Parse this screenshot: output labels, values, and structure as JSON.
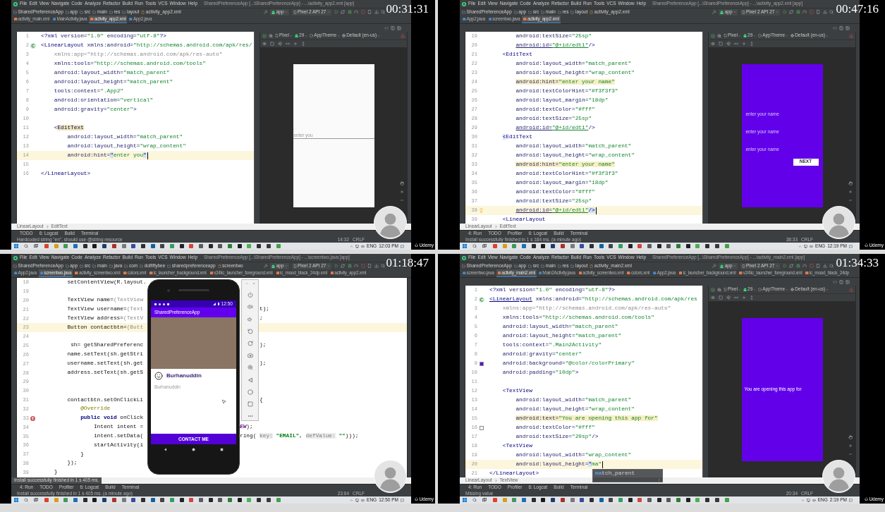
{
  "frames": [
    {
      "timestamp": "00:31:31",
      "menu": [
        "File",
        "Edit",
        "View",
        "Navigate",
        "Code",
        "Analyze",
        "Refactor",
        "Build",
        "Run",
        "Tools",
        "VCS",
        "Window",
        "Help"
      ],
      "window_title": "SharedPreferenceApp [...\\SharedPreferenceApp] - ...\\activity_app2.xml [app]",
      "path": [
        "SharedPreferenceApp",
        "app",
        "src",
        "main",
        "res",
        "layout",
        "activity_app2.xml"
      ],
      "run_config": "app",
      "device": "Pixel 2 API 27",
      "tabs": [
        {
          "label": "activity_main.xml",
          "kind": "xml",
          "selected": false
        },
        {
          "label": "MainActivity.java",
          "kind": "java",
          "selected": false
        },
        {
          "label": "activity_app2.xml",
          "kind": "xml",
          "selected": true
        },
        {
          "label": "App2.java",
          "kind": "java",
          "selected": false
        }
      ],
      "editor": {
        "lines": [
          {
            "number": "1",
            "current": false,
            "caret": false,
            "tokens": [
              {
                "kind": "tag",
                "text": "<?xml"
              },
              {
                "kind": "attr",
                "text": " version="
              },
              {
                "kind": "value",
                "text": "\"1.0\""
              },
              {
                "kind": "attr",
                "text": " encoding="
              },
              {
                "kind": "value",
                "text": "\"utf-8\""
              },
              {
                "kind": "tag",
                "text": "?>"
              }
            ]
          },
          {
            "number": "2",
            "current": false,
            "caret": false,
            "gutter": {
              "kind": "class"
            },
            "tokens": [
              {
                "kind": "tag",
                "text": "<LinearLayout"
              },
              {
                "kind": "attr",
                "text": " xmlns:android="
              },
              {
                "kind": "value",
                "text": "\"http://schemas.android.com/apk/res/"
              }
            ]
          },
          {
            "number": "3",
            "current": false,
            "caret": false,
            "tokens": [
              {
                "kind": "unused",
                "text": "    xmlns:app=\"http://schemas.android.com/apk/res-auto\""
              }
            ]
          },
          {
            "number": "4",
            "current": false,
            "caret": false,
            "tokens": [
              {
                "kind": "attr",
                "text": "    xmlns:tools="
              },
              {
                "kind": "value",
                "text": "\"http://schemas.android.com/tools\""
              }
            ]
          },
          {
            "number": "5",
            "current": false,
            "caret": false,
            "tokens": [
              {
                "kind": "attr",
                "text": "    android:layout_width="
              },
              {
                "kind": "value",
                "text": "\"match_parent\""
              }
            ]
          },
          {
            "number": "6",
            "current": false,
            "caret": false,
            "tokens": [
              {
                "kind": "attr",
                "text": "    android:layout_height="
              },
              {
                "kind": "value",
                "text": "\"match_parent\""
              }
            ]
          },
          {
            "number": "7",
            "current": false,
            "caret": false,
            "tokens": [
              {
                "kind": "attr",
                "text": "    tools:context="
              },
              {
                "kind": "value",
                "text": "\".App2\""
              }
            ]
          },
          {
            "number": "8",
            "current": false,
            "caret": false,
            "tokens": [
              {
                "kind": "attr",
                "text": "    android:orientation="
              },
              {
                "kind": "value",
                "text": "\"vertical\""
              }
            ]
          },
          {
            "number": "9",
            "current": false,
            "caret": false,
            "tokens": [
              {
                "kind": "attr",
                "text": "    android:gravity="
              },
              {
                "kind": "value",
                "text": "\"center\""
              },
              {
                "kind": "tag",
                "text": ">"
              }
            ]
          },
          {
            "number": "10",
            "current": false,
            "caret": false
          },
          {
            "number": "11",
            "current": false,
            "caret": false,
            "tokens": [
              {
                "kind": "tag",
                "text": "    <"
              },
              {
                "kind": "tag-marked",
                "text": "EditText"
              }
            ]
          },
          {
            "number": "12",
            "current": false,
            "caret": false,
            "tokens": [
              {
                "kind": "attr",
                "text": "        android:layout_width="
              },
              {
                "kind": "value",
                "text": "\"match_parent\""
              }
            ]
          },
          {
            "number": "13",
            "current": false,
            "caret": false,
            "tokens": [
              {
                "kind": "attr",
                "text": "        android:layout_height="
              },
              {
                "kind": "value",
                "text": "\"wrap_content\""
              }
            ]
          },
          {
            "number": "14",
            "current": true,
            "caret": true,
            "tokens": [
              {
                "kind": "attr",
                "text": "        android:hint="
              },
              {
                "kind": "match",
                "text": "\""
              },
              {
                "kind": "value",
                "text": "enter you"
              },
              {
                "kind": "match",
                "text": "\""
              }
            ]
          },
          {
            "number": "15",
            "current": false,
            "caret": false
          },
          {
            "number": "16",
            "current": false,
            "caret": false,
            "tokens": [
              {
                "kind": "tag",
                "text": "</LinearLayout>"
              }
            ]
          }
        ]
      },
      "design": {
        "toolbar": [
          "Pixel",
          "29",
          "AppTheme",
          "Default (en-us)"
        ],
        "kind": "light",
        "items": [
          {
            "kind": "edit-line",
            "text": "enter you"
          }
        ]
      },
      "structure_path": [
        "LinearLayout",
        "EditText"
      ],
      "tool_windows": [
        "TODO",
        "6: Logcat",
        "Build",
        "Terminal"
      ],
      "status": "Hardcoded string \"en\", should use @string resource",
      "position": "14:32",
      "line_separator": "CRLF",
      "taskbar": {
        "language": "ENG",
        "time": "12:03 PM"
      },
      "logo": "Udemy"
    },
    {
      "timestamp": "00:47:16",
      "menu": [
        "File",
        "Edit",
        "View",
        "Navigate",
        "Code",
        "Analyze",
        "Refactor",
        "Build",
        "Run",
        "Tools",
        "VCS",
        "Window",
        "Help"
      ],
      "window_title": "SharedPreferenceApp [...\\SharedPreferenceApp] - ...\\activity_app2.xml [app]",
      "path": [
        "SharedPreferenceApp",
        "app",
        "src",
        "main",
        "res",
        "layout",
        "activity_app2.xml"
      ],
      "run_config": "app",
      "device": "Pixel 2 API 27",
      "tabs": [
        {
          "label": "App2.java",
          "kind": "java",
          "selected": false
        },
        {
          "label": "screentwo.java",
          "kind": "java",
          "selected": false
        },
        {
          "label": "activity_app2.xml",
          "kind": "xml",
          "selected": true
        }
      ],
      "editor": {
        "lines": [
          {
            "number": "19",
            "current": false,
            "caret": false,
            "tokens": [
              {
                "kind": "attr",
                "text": "        android:textSize="
              },
              {
                "kind": "value",
                "text": "\"25sp\""
              }
            ]
          },
          {
            "number": "20",
            "current": false,
            "caret": false,
            "tokens": [
              {
                "kind": "attr-error",
                "text": "        android:id="
              },
              {
                "kind": "value-error",
                "text": "\"@+id/edt1\""
              },
              {
                "kind": "tag",
                "text": "/>"
              }
            ]
          },
          {
            "number": "21",
            "current": false,
            "caret": false,
            "tokens": [
              {
                "kind": "tag",
                "text": "    <EditText"
              }
            ]
          },
          {
            "number": "22",
            "current": false,
            "caret": false,
            "tokens": [
              {
                "kind": "attr",
                "text": "        android:layout_width="
              },
              {
                "kind": "value",
                "text": "\"match_parent\""
              }
            ]
          },
          {
            "number": "23",
            "current": false,
            "caret": false,
            "tokens": [
              {
                "kind": "attr",
                "text": "        android:layout_height="
              },
              {
                "kind": "value",
                "text": "\"wrap_content\""
              }
            ]
          },
          {
            "number": "24",
            "current": false,
            "caret": false,
            "tokens": [
              {
                "kind": "attr-warn",
                "text": "        android:hint="
              },
              {
                "kind": "value-warn",
                "text": "\"enter your name\""
              }
            ]
          },
          {
            "number": "25",
            "current": false,
            "caret": false,
            "tokens": [
              {
                "kind": "attr",
                "text": "        android:textColorHint="
              },
              {
                "kind": "value",
                "text": "\"#f3f3f3\""
              }
            ]
          },
          {
            "number": "26",
            "current": false,
            "caret": false,
            "tokens": [
              {
                "kind": "attr",
                "text": "        android:layout_margin="
              },
              {
                "kind": "value",
                "text": "\"18dp\""
              }
            ]
          },
          {
            "number": "27",
            "current": false,
            "caret": false,
            "tokens": [
              {
                "kind": "attr",
                "text": "        android:textColor="
              },
              {
                "kind": "value",
                "text": "\"#fff\""
              }
            ]
          },
          {
            "number": "28",
            "current": false,
            "caret": false,
            "tokens": [
              {
                "kind": "attr",
                "text": "        android:textSize="
              },
              {
                "kind": "value",
                "text": "\"25sp\""
              }
            ]
          },
          {
            "number": "29",
            "current": false,
            "caret": false,
            "tokens": [
              {
                "kind": "attr-error",
                "text": "        android:id="
              },
              {
                "kind": "value-error",
                "text": "\"@+id/edt1\""
              },
              {
                "kind": "tag",
                "text": "/>"
              }
            ]
          },
          {
            "number": "30",
            "current": false,
            "caret": false,
            "tokens": [
              {
                "kind": "match",
                "text": "    <"
              },
              {
                "kind": "tag",
                "text": "EditText"
              }
            ]
          },
          {
            "number": "31",
            "current": false,
            "caret": false,
            "tokens": [
              {
                "kind": "attr",
                "text": "        android:layout_width="
              },
              {
                "kind": "value",
                "text": "\"match_parent\""
              }
            ]
          },
          {
            "number": "32",
            "current": false,
            "caret": false,
            "tokens": [
              {
                "kind": "attr",
                "text": "        android:layout_height="
              },
              {
                "kind": "value",
                "text": "\"wrap_content\""
              }
            ]
          },
          {
            "number": "33",
            "current": false,
            "caret": false,
            "tokens": [
              {
                "kind": "attr-warn",
                "text": "        android:hint="
              },
              {
                "kind": "value-warn",
                "text": "\"enter your name\""
              }
            ]
          },
          {
            "number": "34",
            "current": false,
            "caret": false,
            "tokens": [
              {
                "kind": "attr",
                "text": "        android:textColorHint="
              },
              {
                "kind": "value",
                "text": "\"#f3f3f3\""
              }
            ]
          },
          {
            "number": "35",
            "current": false,
            "caret": false,
            "tokens": [
              {
                "kind": "attr",
                "text": "        android:layout_margin="
              },
              {
                "kind": "value",
                "text": "\"18dp\""
              }
            ]
          },
          {
            "number": "36",
            "current": false,
            "caret": false,
            "tokens": [
              {
                "kind": "attr",
                "text": "        android:textColor="
              },
              {
                "kind": "value",
                "text": "\"#fff\""
              }
            ]
          },
          {
            "number": "37",
            "current": false,
            "caret": false,
            "tokens": [
              {
                "kind": "attr",
                "text": "        android:textSize="
              },
              {
                "kind": "value",
                "text": "\"25sp\""
              }
            ]
          },
          {
            "number": "38",
            "current": true,
            "caret": true,
            "gutter": {
              "kind": "bulb"
            },
            "tokens": [
              {
                "kind": "attr-error",
                "text": "        android:id="
              },
              {
                "kind": "value-error",
                "text": "\"@+id/edt1\""
              },
              {
                "kind": "match",
                "text": "/>"
              }
            ]
          },
          {
            "number": "39",
            "current": false,
            "caret": false,
            "tokens": [
              {
                "kind": "tag",
                "text": "    <LinearLayout"
              }
            ]
          }
        ]
      },
      "design": {
        "toolbar": [
          "Pixel",
          "29",
          "AppTheme",
          "Default (en-us)"
        ],
        "kind": "primary",
        "items": [
          {
            "kind": "hint",
            "text": "enter your name"
          },
          {
            "kind": "hint",
            "text": "enter your name"
          },
          {
            "kind": "hint",
            "text": "enter your name"
          },
          {
            "kind": "button",
            "text": "NEXT"
          }
        ]
      },
      "structure_path": [
        "LinearLayout",
        "EditText"
      ],
      "tool_windows": [
        "4: Run",
        "TODO",
        "Profiler",
        "6: Logcat",
        "Build",
        "Terminal"
      ],
      "status": "Install successfully finished in 1 s 184 ms. (a minute ago)",
      "position": "38:33",
      "line_separator": "CRLF",
      "taskbar": {
        "language": "ENG",
        "time": "12:19 PM"
      },
      "logo": "Udemy"
    },
    {
      "timestamp": "01:18:47",
      "menu": [
        "File",
        "Edit",
        "View",
        "Navigate",
        "Code",
        "Analyze",
        "Refactor",
        "Build",
        "Run",
        "Tools",
        "VCS",
        "Window",
        "Help"
      ],
      "window_title": "SharedPreferenceApp [...\\SharedPreferenceApp] - ...\\screentwo.java [app]",
      "path": [
        "SharedPreferenceApp",
        "app",
        "src",
        "main",
        "java",
        "com",
        "dolfiftybee",
        "sharedpreferenceapp",
        "screentwo"
      ],
      "run_config": "app",
      "device": "Pixel 2 API 27",
      "tabs": [
        {
          "label": "App2.java",
          "kind": "java",
          "selected": false
        },
        {
          "label": "screentwo.java",
          "kind": "java",
          "selected": true
        },
        {
          "label": "activity_screentwo.xml",
          "kind": "xml",
          "selected": false
        },
        {
          "label": "colors.xml",
          "kind": "xml",
          "selected": false
        },
        {
          "label": "ic_launcher_background.xml",
          "kind": "xml",
          "selected": false
        },
        {
          "label": "v24\\ic_launcher_foreground.xml",
          "kind": "xml",
          "selected": false
        },
        {
          "label": "ic_mood_black_24dp.xml",
          "kind": "xml",
          "selected": false
        },
        {
          "label": "activity_app2.xml",
          "kind": "xml",
          "selected": false
        }
      ],
      "editor": {
        "lines": [
          {
            "number": "18",
            "current": false,
            "caret": false,
            "tokens": [
              {
                "kind": "plain",
                "text": "        setContentView(R.layout."
              }
            ]
          },
          {
            "number": "19",
            "current": false,
            "caret": false
          },
          {
            "number": "20",
            "current": false,
            "caret": false,
            "tokens": [
              {
                "kind": "plain",
                "text": "        TextView name="
              },
              {
                "kind": "cast",
                "text": "(TextView"
              }
            ]
          },
          {
            "number": "21",
            "current": false,
            "caret": false,
            "tokens": [
              {
                "kind": "plain",
                "text": "        TextView username="
              },
              {
                "kind": "cast",
                "text": "(Text"
              }
            ],
            "tail": [
              {
                "kind": "plain",
                "text": "t);"
              }
            ]
          },
          {
            "number": "22",
            "current": false,
            "caret": false,
            "tokens": [
              {
                "kind": "plain",
                "text": "        TextView address="
              },
              {
                "kind": "cast",
                "text": "(TextV"
              }
            ],
            "tail": [
              {
                "kind": "plain",
                "text": ";"
              }
            ]
          },
          {
            "number": "23",
            "current": true,
            "caret": false,
            "tokens": [
              {
                "kind": "plain",
                "text": "        Button contactbtn="
              },
              {
                "kind": "cast",
                "text": "(Butt"
              }
            ]
          },
          {
            "number": "24",
            "current": false,
            "caret": false
          },
          {
            "number": "25",
            "current": false,
            "caret": false,
            "tokens": [
              {
                "kind": "plain",
                "text": "         sh= getSharedPreferenc"
              }
            ],
            "tail": [
              {
                "kind": "plain",
                "text": ");"
              }
            ]
          },
          {
            "number": "26",
            "current": false,
            "caret": false,
            "tokens": [
              {
                "kind": "plain",
                "text": "        name.setText(sh.getStri"
              }
            ]
          },
          {
            "number": "27",
            "current": false,
            "caret": false,
            "tokens": [
              {
                "kind": "plain",
                "text": "        username.setText(sh.get"
              }
            ],
            "tail": [
              {
                "kind": "plain",
                "text": ");"
              }
            ]
          },
          {
            "number": "28",
            "current": false,
            "caret": false,
            "tokens": [
              {
                "kind": "plain",
                "text": "        address.setText(sh.getS"
              }
            ]
          },
          {
            "number": "29",
            "current": false,
            "caret": false
          },
          {
            "number": "30",
            "current": false,
            "caret": false
          },
          {
            "number": "31",
            "current": false,
            "caret": false,
            "tokens": [
              {
                "kind": "plain",
                "text": "        contactbtn.setOnClickLi"
              }
            ],
            "tail": [
              {
                "kind": "plain",
                "text": "{"
              }
            ]
          },
          {
            "number": "32",
            "current": false,
            "caret": false,
            "tokens": [
              {
                "kind": "annotation",
                "text": "            @Override"
              }
            ]
          },
          {
            "number": "33",
            "current": false,
            "caret": false,
            "gutter": {
              "kind": "override"
            },
            "tokens": [
              {
                "kind": "keyword",
                "text": "            public void "
              },
              {
                "kind": "plain",
                "text": "onClick"
              }
            ]
          },
          {
            "number": "34",
            "current": false,
            "caret": false,
            "tokens": [
              {
                "kind": "plain",
                "text": "                Intent intent ="
              }
            ],
            "tail": [
              {
                "kind": "constant",
                "text": "EW"
              },
              {
                "kind": "plain",
                "text": ");"
              }
            ]
          },
          {
            "number": "35",
            "current": false,
            "caret": false,
            "tokens": [
              {
                "kind": "plain",
                "text": "                intent.setData("
              }
            ],
            "tail": [
              {
                "kind": "plain",
                "text": "ring( "
              },
              {
                "kind": "param-hint",
                "text": "key:"
              },
              {
                "kind": "string",
                "text": " \"EMAIL\""
              },
              {
                "kind": "plain",
                "text": ", "
              },
              {
                "kind": "param-hint",
                "text": "defValue:"
              },
              {
                "kind": "string",
                "text": " \"\""
              },
              {
                "kind": "plain",
                "text": ")));"
              }
            ]
          },
          {
            "number": "36",
            "current": false,
            "caret": false,
            "tokens": [
              {
                "kind": "plain",
                "text": "                startActivity(i"
              }
            ]
          },
          {
            "number": "37",
            "current": false,
            "caret": false,
            "tokens": [
              {
                "kind": "plain",
                "text": "            }"
              }
            ]
          },
          {
            "number": "38",
            "current": false,
            "caret": false,
            "tokens": [
              {
                "kind": "plain",
                "text": "        });"
              }
            ]
          },
          {
            "number": "39",
            "current": false,
            "caret": false,
            "tokens": [
              {
                "kind": "plain",
                "text": "    }"
              }
            ]
          }
        ]
      },
      "emulator": {
        "status_time": "12:50",
        "app_title": "SharedPreferenceApp",
        "name": "Burhanuddin",
        "username": "Burhanuddin",
        "button": "CONTACT ME"
      },
      "notification": "Install successfully finished in 1 s 405 ms.",
      "tool_windows": [
        "4: Run",
        "TODO",
        "Profiler",
        "6: Logcat",
        "Build",
        "Terminal"
      ],
      "status": "Install successfully finished in 1 s 405 ms. (a minute ago)",
      "position": "23:64",
      "line_separator": "CRLF",
      "taskbar": {
        "language": "ENG",
        "time": "12:50 PM"
      },
      "logo": "Udemy"
    },
    {
      "timestamp": "01:34:33",
      "menu": [
        "File",
        "Edit",
        "View",
        "Navigate",
        "Code",
        "Analyze",
        "Refactor",
        "Build",
        "Run",
        "Tools",
        "VCS",
        "Window",
        "Help"
      ],
      "window_title": "SharedPreferenceApp [...\\SharedPreferenceApp] - ...\\activity_main2.xml [app]",
      "path": [
        "SharedPreferenceApp",
        "app",
        "src",
        "main",
        "res",
        "layout",
        "activity_main2.xml"
      ],
      "run_config": "app",
      "device": "Pixel 2 API 27",
      "tabs": [
        {
          "label": "screentwo.java",
          "kind": "java",
          "selected": false
        },
        {
          "label": "activity_main2.xml",
          "kind": "xml",
          "selected": true
        },
        {
          "label": "Main2Activity.java",
          "kind": "java",
          "selected": false
        },
        {
          "label": "activity_screentwo.xml",
          "kind": "xml",
          "selected": false
        },
        {
          "label": "colors.xml",
          "kind": "xml",
          "selected": false
        },
        {
          "label": "App2.java",
          "kind": "java",
          "selected": false
        },
        {
          "label": "ic_launcher_background.xml",
          "kind": "xml",
          "selected": false
        },
        {
          "label": "v24\\ic_launcher_foreground.xml",
          "kind": "xml",
          "selected": false
        },
        {
          "label": "ic_mood_black_24dp",
          "kind": "xml",
          "selected": false
        }
      ],
      "editor": {
        "lines": [
          {
            "number": "1",
            "current": false,
            "caret": false,
            "tokens": [
              {
                "kind": "tag",
                "text": "<?xml"
              },
              {
                "kind": "attr",
                "text": " version="
              },
              {
                "kind": "value",
                "text": "\"1.0\""
              },
              {
                "kind": "attr",
                "text": " encoding="
              },
              {
                "kind": "value",
                "text": "\"utf-8\""
              },
              {
                "kind": "tag",
                "text": "?>"
              }
            ]
          },
          {
            "number": "2",
            "current": false,
            "caret": false,
            "gutter": {
              "kind": "class"
            },
            "tokens": [
              {
                "kind": "tag-error",
                "text": "<LinearLayout"
              },
              {
                "kind": "attr",
                "text": " xmlns:android="
              },
              {
                "kind": "value",
                "text": "\"http://schemas.android.com/apk/res"
              }
            ]
          },
          {
            "number": "3",
            "current": false,
            "caret": false,
            "tokens": [
              {
                "kind": "unused",
                "text": "    xmlns:app=\"http://schemas.android.com/apk/res-auto\""
              }
            ]
          },
          {
            "number": "4",
            "current": false,
            "caret": false,
            "tokens": [
              {
                "kind": "attr",
                "text": "    xmlns:tools="
              },
              {
                "kind": "value",
                "text": "\"http://schemas.android.com/tools\""
              }
            ]
          },
          {
            "number": "5",
            "current": false,
            "caret": false,
            "tokens": [
              {
                "kind": "attr",
                "text": "    android:layout_width="
              },
              {
                "kind": "value",
                "text": "\"match_parent\""
              }
            ]
          },
          {
            "number": "6",
            "current": false,
            "caret": false,
            "tokens": [
              {
                "kind": "attr",
                "text": "    android:layout_height="
              },
              {
                "kind": "value",
                "text": "\"match_parent\""
              }
            ]
          },
          {
            "number": "7",
            "current": false,
            "caret": false,
            "tokens": [
              {
                "kind": "attr",
                "text": "    tools:context="
              },
              {
                "kind": "value",
                "text": "\".Main2Activity\""
              }
            ]
          },
          {
            "number": "8",
            "current": false,
            "caret": false,
            "tokens": [
              {
                "kind": "attr",
                "text": "    android:gravity="
              },
              {
                "kind": "value",
                "text": "\"center\""
              }
            ]
          },
          {
            "number": "9",
            "current": false,
            "caret": false,
            "gutter": {
              "kind": "swatch",
              "color": "#5b12d6"
            },
            "tokens": [
              {
                "kind": "attr",
                "text": "    android:background="
              },
              {
                "kind": "value",
                "text": "\"@color/colorPrimary\""
              }
            ]
          },
          {
            "number": "10",
            "current": false,
            "caret": false,
            "tokens": [
              {
                "kind": "attr",
                "text": "    android:padding="
              },
              {
                "kind": "value",
                "text": "\"10dp\""
              },
              {
                "kind": "tag",
                "text": ">"
              }
            ]
          },
          {
            "number": "11",
            "current": false,
            "caret": false
          },
          {
            "number": "12",
            "current": false,
            "caret": false,
            "tokens": [
              {
                "kind": "tag",
                "text": "    <TextView"
              }
            ]
          },
          {
            "number": "13",
            "current": false,
            "caret": false,
            "tokens": [
              {
                "kind": "attr",
                "text": "        android:layout_width="
              },
              {
                "kind": "value",
                "text": "\"match_parent\""
              }
            ]
          },
          {
            "number": "14",
            "current": false,
            "caret": false,
            "tokens": [
              {
                "kind": "attr",
                "text": "        android:layout_height="
              },
              {
                "kind": "value",
                "text": "\"wrap_content\""
              }
            ]
          },
          {
            "number": "15",
            "current": false,
            "caret": false,
            "tokens": [
              {
                "kind": "attr-warn",
                "text": "        android:text="
              },
              {
                "kind": "value-warn",
                "text": "\"You are opening this app for\""
              }
            ]
          },
          {
            "number": "16",
            "current": false,
            "caret": false,
            "gutter": {
              "kind": "swatch",
              "color": "#ffffff"
            },
            "tokens": [
              {
                "kind": "attr",
                "text": "        android:textColor="
              },
              {
                "kind": "value",
                "text": "\"#fff\""
              }
            ]
          },
          {
            "number": "17",
            "current": false,
            "caret": false,
            "tokens": [
              {
                "kind": "attr",
                "text": "        android:textSize="
              },
              {
                "kind": "value",
                "text": "\"20sp\""
              },
              {
                "kind": "tag",
                "text": "/>"
              }
            ]
          },
          {
            "number": "18",
            "current": false,
            "caret": false,
            "tokens": [
              {
                "kind": "tag",
                "text": "    <TextView"
              }
            ]
          },
          {
            "number": "19",
            "current": false,
            "caret": false,
            "tokens": [
              {
                "kind": "attr",
                "text": "        android:layout_width="
              },
              {
                "kind": "value",
                "text": "\"wrap_content\""
              }
            ]
          },
          {
            "number": "20",
            "current": true,
            "caret": true,
            "tokens": [
              {
                "kind": "attr",
                "text": "        android:layout_height="
              },
              {
                "kind": "match",
                "text": "\""
              },
              {
                "kind": "value",
                "text": "ma\""
              }
            ]
          },
          {
            "number": "21",
            "current": false,
            "caret": false,
            "tokens": [
              {
                "kind": "tag",
                "text": "</LinearLayout>"
              }
            ]
          }
        ],
        "autocomplete": {
          "suggestion": "**ma**tch_parent"
        }
      },
      "design": {
        "toolbar": [
          "Pixel",
          "29",
          "AppTheme",
          "Default (en-us)"
        ],
        "kind": "primary",
        "items": [
          {
            "kind": "text",
            "text": "You are opening this app for"
          }
        ]
      },
      "structure_path": [
        "LinearLayout",
        "TextView"
      ],
      "tool_windows": [
        "4: Run",
        "TODO",
        "Profiler",
        "6: Logcat",
        "Build",
        "Terminal"
      ],
      "status": "Missing value",
      "position": "20:34",
      "line_separator": "CRLF",
      "taskbar": {
        "language": "ENG",
        "time": "2:19 PM"
      },
      "logo": "Udemy"
    }
  ]
}
